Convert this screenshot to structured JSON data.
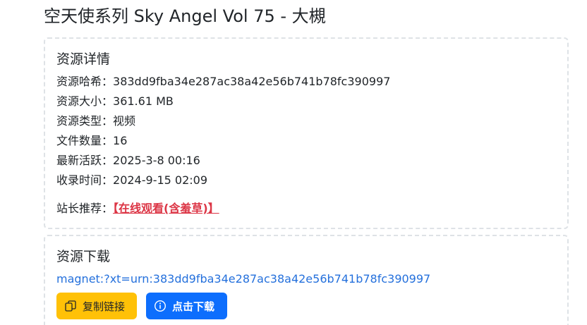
{
  "page": {
    "title": "空天使系列 Sky Angel Vol 75 - 大槻"
  },
  "details": {
    "heading": "资源详情",
    "rows": [
      {
        "label": "资源哈希：",
        "value": "383dd9fba34e287ac38a42e56b741b78fc390997"
      },
      {
        "label": "资源大小：",
        "value": "361.61 MB"
      },
      {
        "label": "资源类型：",
        "value": "视频"
      },
      {
        "label": "文件数量：",
        "value": "16"
      },
      {
        "label": "最新活跃：",
        "value": "2025-3-8 00:16"
      },
      {
        "label": "收录时间：",
        "value": "2024-9-15 02:09"
      }
    ],
    "recommend": {
      "label": "站长推荐：",
      "link_text": "【在线观看(含羞草)】"
    }
  },
  "download": {
    "heading": "资源下载",
    "magnet": "magnet:?xt=urn:383dd9fba34e287ac38a42e56b741b78fc390997",
    "copy_button": {
      "label": "复制链接",
      "icon": "copy-icon"
    },
    "download_button": {
      "label": "点击下载",
      "icon": "info-circle-icon"
    }
  },
  "colors": {
    "warning": "#ffc107",
    "primary": "#0d6efd",
    "danger": "#dc3545",
    "link": "#2470dc"
  }
}
